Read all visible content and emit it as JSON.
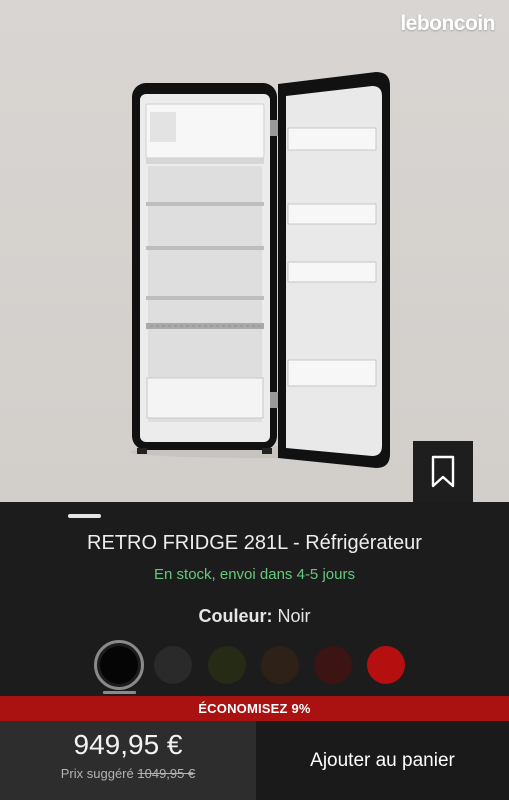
{
  "brand": {
    "watermark": "leboncoin"
  },
  "product": {
    "name": "RETRO FRIDGE 281L",
    "separator": " - ",
    "category": "Réfrigérateur",
    "availability": "En stock, envoi dans 4-5 jours",
    "color_label": "Couleur:",
    "color_value": "Noir"
  },
  "swatches": [
    {
      "name": "black",
      "color": "#050505",
      "selected": true
    },
    {
      "name": "dark-grey",
      "color": "#2a2a2a",
      "selected": false
    },
    {
      "name": "olive",
      "color": "#262b16",
      "selected": false
    },
    {
      "name": "brown",
      "color": "#2e2117",
      "selected": false
    },
    {
      "name": "burgundy",
      "color": "#3d1414",
      "selected": false
    },
    {
      "name": "red",
      "color": "#b50f0f",
      "selected": false
    }
  ],
  "promo": {
    "label": "ÉCONOMISEZ 9%"
  },
  "pricing": {
    "price": "949,95 €",
    "suggested_label": "Prix suggéré",
    "suggested_price": "1049,95 €"
  },
  "actions": {
    "add_to_cart": "Ajouter au panier"
  },
  "colors": {
    "promo_bg": "#aa1212",
    "stock_text": "#66c97a"
  }
}
